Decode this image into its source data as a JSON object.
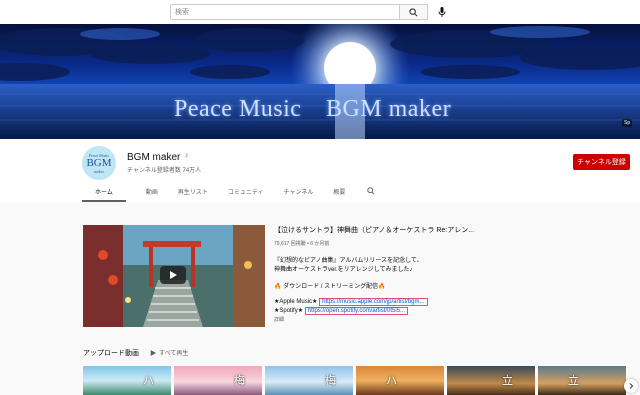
{
  "search": {
    "placeholder": "検索"
  },
  "banner": {
    "title": "Peace Music　BGM maker",
    "badge": "Sp"
  },
  "channel": {
    "avatar_top": "Peace Music",
    "avatar_mid": "BGM",
    "avatar_bottom": "maker",
    "name": "BGM maker",
    "note_icon": "♪",
    "subscribers": "チャンネル登録者数 74万人",
    "subscribe_label": "チャンネル登録"
  },
  "tabs": [
    {
      "label": "ホーム",
      "active": true
    },
    {
      "label": "動画"
    },
    {
      "label": "再生リスト"
    },
    {
      "label": "コミュニティ"
    },
    {
      "label": "チャンネル"
    },
    {
      "label": "概要"
    }
  ],
  "featured": {
    "title": "【泣けるサントラ】神舞曲（ピアノ＆オーケストラ Re:アレン...",
    "meta": "79,617 回視聴 • 6 か月前",
    "desc_line1": "『幻想的なピアノ曲集』アルバムリリースを記念して、",
    "desc_line2": "神舞曲オーケストラver.をリアレンジしてみました♪",
    "desc_line3": "🔥 ダウンロード / ストリーミング配信🔥",
    "apple_label": "★Apple Music★",
    "apple_link": "https://music.apple.com/jp/artist/bgm...",
    "spotify_label": "★Spotify★",
    "spotify_link": "https://open.spotify.com/artist/0t5i5...",
    "more": "詳細"
  },
  "uploads": {
    "title": "アップロード動画",
    "play_all": "すべて再生",
    "thumb_texts": [
      "ハ",
      "梅",
      "梅",
      "ハ",
      "立",
      "立"
    ]
  },
  "colors": {
    "accent": "#cc0000",
    "link": "#065fd4"
  },
  "icons": [
    "search-icon",
    "mic-icon",
    "play-icon",
    "chevron-right-icon"
  ]
}
